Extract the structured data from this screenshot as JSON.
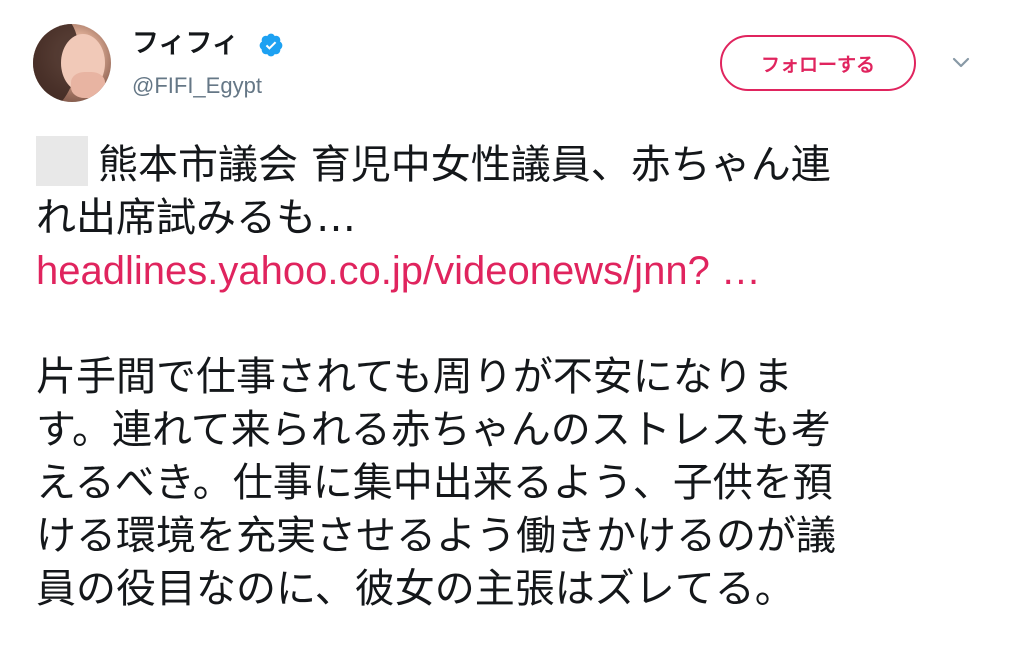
{
  "author": {
    "display_name": "フィフィ",
    "handle": "@FIFI_Egypt",
    "verified": true
  },
  "actions": {
    "follow_label": "フォローする",
    "menu_icon": "chevron-down-icon"
  },
  "tweet": {
    "headline_lines": [
      "熊本市議会 育児中女性議員、赤ちゃん連",
      "れ出席試みるも…"
    ],
    "link": "headlines.yahoo.co.jp/videonews/jnn? …",
    "comment_lines": [
      "片手間で仕事されても周りが不安になりま",
      "す。連れて来られる赤ちゃんのストレスも考",
      "えるべき。仕事に集中出来るよう、子供を預",
      "ける環境を充実させるよう働きかけるのが議",
      "員の役目なのに、彼女の主張はズレてる。"
    ]
  },
  "colors": {
    "accent": "#e0245e",
    "verified_blue": "#1da1f2",
    "text": "#14171a",
    "secondary": "#657786"
  }
}
